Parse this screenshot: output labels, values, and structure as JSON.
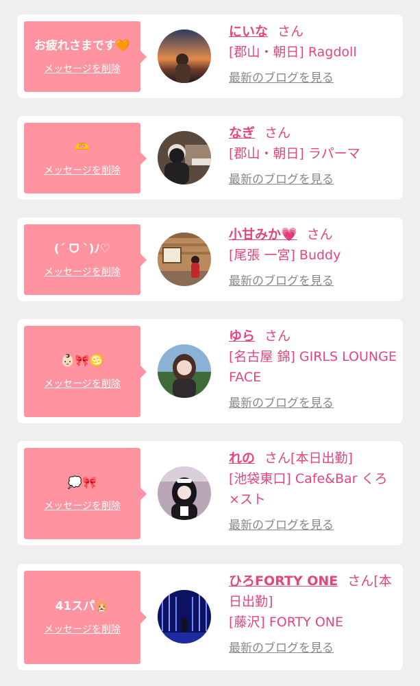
{
  "colors": {
    "bubble": "#ff939f",
    "accent": "#e6457a",
    "link_gray": "#888888",
    "background": "#efefef"
  },
  "delete_label": "メッセージを削除",
  "blog_label": "最新のブログを見る",
  "san_label": "さん",
  "cards": [
    {
      "message": "お疲れさまです🧡",
      "name": "にいな",
      "suffix": "",
      "shop": "[郡山・朝日] Ragdoll",
      "avatar": "sunset-photo"
    },
    {
      "message": "🫶",
      "name": "なぎ",
      "suffix": "",
      "shop": "[郡山・朝日] ラパーマ",
      "avatar": "cafe-photo"
    },
    {
      "message": "(ˊ ᗜ ˋ)ﾉ♡",
      "name": "小甘みか💗",
      "suffix": "",
      "shop": "[尾張 一宮] Buddy",
      "avatar": "cabin-photo"
    },
    {
      "message": "👶🏻🎀♋️",
      "name": "ゆら",
      "suffix": "",
      "shop": "[名古屋 錦] GIRLS LOUNGE FACE",
      "avatar": "girl-photo"
    },
    {
      "message": "💭🎀",
      "name": "れの",
      "suffix": "[本日出勤]",
      "shop": "[池袋東口] Cafe&Bar くろ×スト",
      "avatar": "maid-photo"
    },
    {
      "message": "41スパ🐹",
      "name": "ひろFORTY ONE",
      "suffix": "[本日出勤]",
      "shop": "[藤沢] FORTY ONE",
      "avatar": "lights-photo"
    }
  ]
}
